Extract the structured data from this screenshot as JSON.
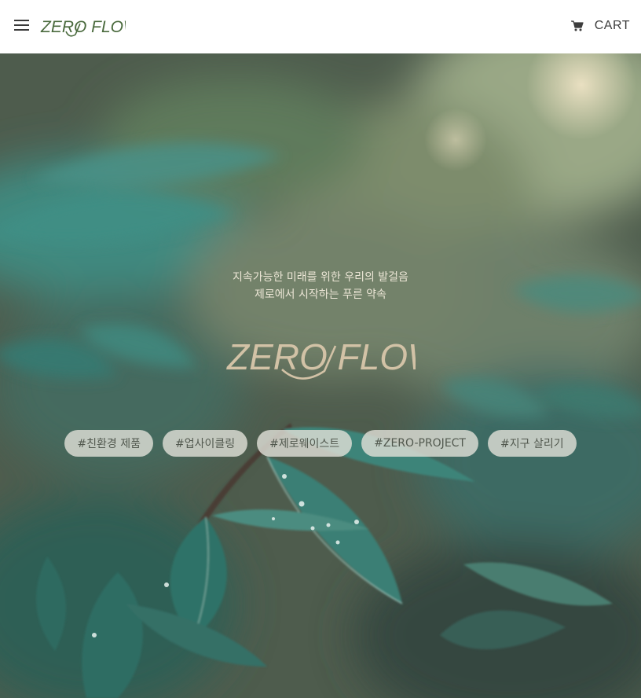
{
  "header": {
    "logo_text": "ZERO FLOW",
    "cart_label": "CART",
    "icons": {
      "menu": "hamburger-menu-icon",
      "cart": "shopping-cart-icon"
    }
  },
  "hero": {
    "tagline_line1": "지속가능한 미래를 위한 우리의 발걸음",
    "tagline_line2": "제로에서 시작하는 푸른 약속",
    "logo_text": "ZERO FLOW",
    "tags": [
      "#친환경 제품",
      "#업사이클링",
      "#제로웨이스트",
      "#ZERO-PROJECT",
      "#지구 살리기"
    ]
  },
  "colors": {
    "brand_green": "#4a6a3d",
    "hero_logo": "#d2c2a6",
    "tag_background": "#deded6",
    "tag_text": "#52594f",
    "foliage": "#3f8a80"
  }
}
